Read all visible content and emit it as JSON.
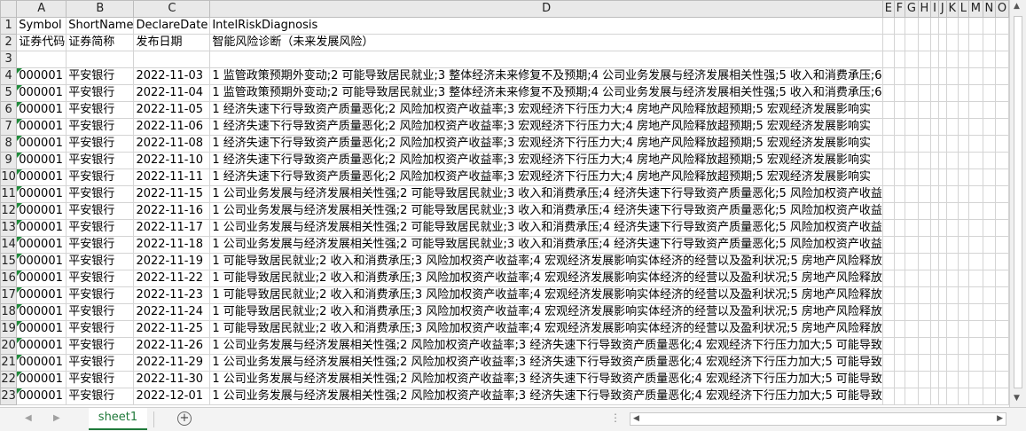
{
  "columns": [
    "A",
    "B",
    "C",
    "D",
    "E",
    "F",
    "G",
    "H",
    "I",
    "J",
    "K",
    "L",
    "M",
    "N",
    "O"
  ],
  "rows": [
    {
      "num": "1",
      "cells": [
        "Symbol",
        "ShortName",
        "DeclareDate",
        "IntelRiskDiagnosis"
      ]
    },
    {
      "num": "2",
      "cells": [
        "证券代码",
        "证券简称",
        "发布日期",
        "智能风险诊断（未来发展风险）"
      ]
    },
    {
      "num": "3",
      "cells": [
        "",
        "",
        "",
        ""
      ]
    },
    {
      "num": "4",
      "cells": [
        "000001",
        "平安银行",
        "2022-11-03",
        "1 监管政策预期外变动;2 可能导致居民就业;3 整体经济未来修复不及预期;4 公司业务发展与经济发展相关性强;5 收入和消费承压;6"
      ]
    },
    {
      "num": "5",
      "cells": [
        "000001",
        "平安银行",
        "2022-11-04",
        "1 监管政策预期外变动;2 可能导致居民就业;3 整体经济未来修复不及预期;4 公司业务发展与经济发展相关性强;5 收入和消费承压;6"
      ]
    },
    {
      "num": "6",
      "cells": [
        "000001",
        "平安银行",
        "2022-11-05",
        "1 经济失速下行导致资产质量恶化;2 风险加权资产收益率;3 宏观经济下行压力大;4 房地产风险释放超预期;5 宏观经济发展影响实"
      ]
    },
    {
      "num": "7",
      "cells": [
        "000001",
        "平安银行",
        "2022-11-06",
        "1 经济失速下行导致资产质量恶化;2 风险加权资产收益率;3 宏观经济下行压力大;4 房地产风险释放超预期;5 宏观经济发展影响实"
      ]
    },
    {
      "num": "8",
      "cells": [
        "000001",
        "平安银行",
        "2022-11-08",
        "1 经济失速下行导致资产质量恶化;2 风险加权资产收益率;3 宏观经济下行压力大;4 房地产风险释放超预期;5 宏观经济发展影响实"
      ]
    },
    {
      "num": "9",
      "cells": [
        "000001",
        "平安银行",
        "2022-11-10",
        "1 经济失速下行导致资产质量恶化;2 风险加权资产收益率;3 宏观经济下行压力大;4 房地产风险释放超预期;5 宏观经济发展影响实"
      ]
    },
    {
      "num": "10",
      "cells": [
        "000001",
        "平安银行",
        "2022-11-11",
        "1 经济失速下行导致资产质量恶化;2 风险加权资产收益率;3 宏观经济下行压力大;4 房地产风险释放超预期;5 宏观经济发展影响实"
      ]
    },
    {
      "num": "11",
      "cells": [
        "000001",
        "平安银行",
        "2022-11-15",
        "1 公司业务发展与经济发展相关性强;2 可能导致居民就业;3 收入和消费承压;4 经济失速下行导致资产质量恶化;5 风险加权资产收益"
      ]
    },
    {
      "num": "12",
      "cells": [
        "000001",
        "平安银行",
        "2022-11-16",
        "1 公司业务发展与经济发展相关性强;2 可能导致居民就业;3 收入和消费承压;4 经济失速下行导致资产质量恶化;5 风险加权资产收益"
      ]
    },
    {
      "num": "13",
      "cells": [
        "000001",
        "平安银行",
        "2022-11-17",
        "1 公司业务发展与经济发展相关性强;2 可能导致居民就业;3 收入和消费承压;4 经济失速下行导致资产质量恶化;5 风险加权资产收益"
      ]
    },
    {
      "num": "14",
      "cells": [
        "000001",
        "平安银行",
        "2022-11-18",
        "1 公司业务发展与经济发展相关性强;2 可能导致居民就业;3 收入和消费承压;4 经济失速下行导致资产质量恶化;5 风险加权资产收益"
      ]
    },
    {
      "num": "15",
      "cells": [
        "000001",
        "平安银行",
        "2022-11-19",
        "1 可能导致居民就业;2 收入和消费承压;3 风险加权资产收益率;4 宏观经济发展影响实体经济的经营以及盈利状况;5 房地产风险释放"
      ]
    },
    {
      "num": "16",
      "cells": [
        "000001",
        "平安银行",
        "2022-11-22",
        "1 可能导致居民就业;2 收入和消费承压;3 风险加权资产收益率;4 宏观经济发展影响实体经济的经营以及盈利状况;5 房地产风险释放"
      ]
    },
    {
      "num": "17",
      "cells": [
        "000001",
        "平安银行",
        "2022-11-23",
        "1 可能导致居民就业;2 收入和消费承压;3 风险加权资产收益率;4 宏观经济发展影响实体经济的经营以及盈利状况;5 房地产风险释放"
      ]
    },
    {
      "num": "18",
      "cells": [
        "000001",
        "平安银行",
        "2022-11-24",
        "1 可能导致居民就业;2 收入和消费承压;3 风险加权资产收益率;4 宏观经济发展影响实体经济的经营以及盈利状况;5 房地产风险释放"
      ]
    },
    {
      "num": "19",
      "cells": [
        "000001",
        "平安银行",
        "2022-11-25",
        "1 可能导致居民就业;2 收入和消费承压;3 风险加权资产收益率;4 宏观经济发展影响实体经济的经营以及盈利状况;5 房地产风险释放"
      ]
    },
    {
      "num": "20",
      "cells": [
        "000001",
        "平安银行",
        "2022-11-26",
        "1 公司业务发展与经济发展相关性强;2 风险加权资产收益率;3 经济失速下行导致资产质量恶化;4 宏观经济下行压力加大;5 可能导致"
      ]
    },
    {
      "num": "21",
      "cells": [
        "000001",
        "平安银行",
        "2022-11-29",
        "1 公司业务发展与经济发展相关性强;2 风险加权资产收益率;3 经济失速下行导致资产质量恶化;4 宏观经济下行压力加大;5 可能导致"
      ]
    },
    {
      "num": "22",
      "cells": [
        "000001",
        "平安银行",
        "2022-11-30",
        "1 公司业务发展与经济发展相关性强;2 风险加权资产收益率;3 经济失速下行导致资产质量恶化;4 宏观经济下行压力加大;5 可能导致"
      ]
    },
    {
      "num": "23",
      "cells": [
        "000001",
        "平安银行",
        "2022-12-01",
        "1 公司业务发展与经济发展相关性强;2 风险加权资产收益率;3 经济失速下行导致资产质量恶化;4 宏观经济下行压力加大;5 可能导致"
      ]
    }
  ],
  "sheet_tab": "sheet1",
  "icons": {
    "add_sheet": "plus-circle-icon",
    "nav_prev": "triangle-left-icon",
    "nav_next": "triangle-right-icon",
    "more": "ellipsis-icon"
  },
  "colors": {
    "accent": "#1f7a3a",
    "error_indicator": "#1f8b3a",
    "header_bg": "#e9e9e9",
    "grid_line": "#d4d4d4"
  }
}
